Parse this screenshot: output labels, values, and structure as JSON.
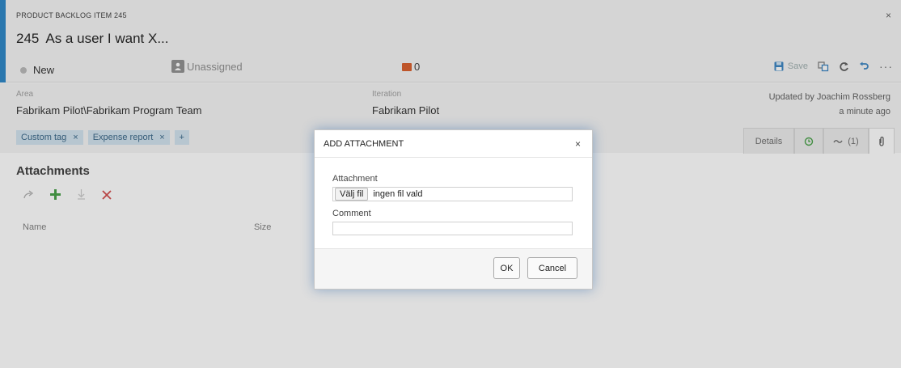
{
  "work_item": {
    "type_label": "PRODUCT BACKLOG ITEM 245",
    "id": "245",
    "title": "As a user I want X...",
    "state": "New",
    "assignee": "Unassigned",
    "discussion_count": "0",
    "close_glyph": "×"
  },
  "toolbar": {
    "save_label": "Save",
    "more_glyph": "···"
  },
  "fields": {
    "area_label": "Area",
    "area_value": "Fabrikam Pilot\\Fabrikam Program Team",
    "iteration_label": "Iteration",
    "iteration_value": "Fabrikam Pilot",
    "updated_by": "Updated by Joachim Rossberg",
    "updated_time": "a minute ago"
  },
  "tags": [
    {
      "label": "Custom tag",
      "remove": "×"
    },
    {
      "label": "Expense report",
      "remove": "×"
    }
  ],
  "tag_add": "+",
  "tabs": [
    {
      "label": "Details",
      "icon": null
    },
    {
      "label": "",
      "icon": "history-icon"
    },
    {
      "label": "(1)",
      "icon": "links-icon"
    },
    {
      "label": "",
      "icon": "paperclip-icon"
    }
  ],
  "attachments": {
    "title": "Attachments",
    "columns": [
      "Name",
      "Size"
    ]
  },
  "dialog": {
    "title": "ADD ATTACHMENT",
    "close_glyph": "×",
    "attachment_label": "Attachment",
    "choose_file_button": "Välj fil",
    "file_status": "ingen fil vald",
    "comment_label": "Comment",
    "comment_value": "",
    "ok_label": "OK",
    "cancel_label": "Cancel"
  },
  "colors": {
    "accent": "#1f7fc4",
    "discussion_icon": "#d8541f",
    "add_icon": "#3a9a3a",
    "delete_icon": "#d04040",
    "tag_bg": "#cfe1ee"
  }
}
